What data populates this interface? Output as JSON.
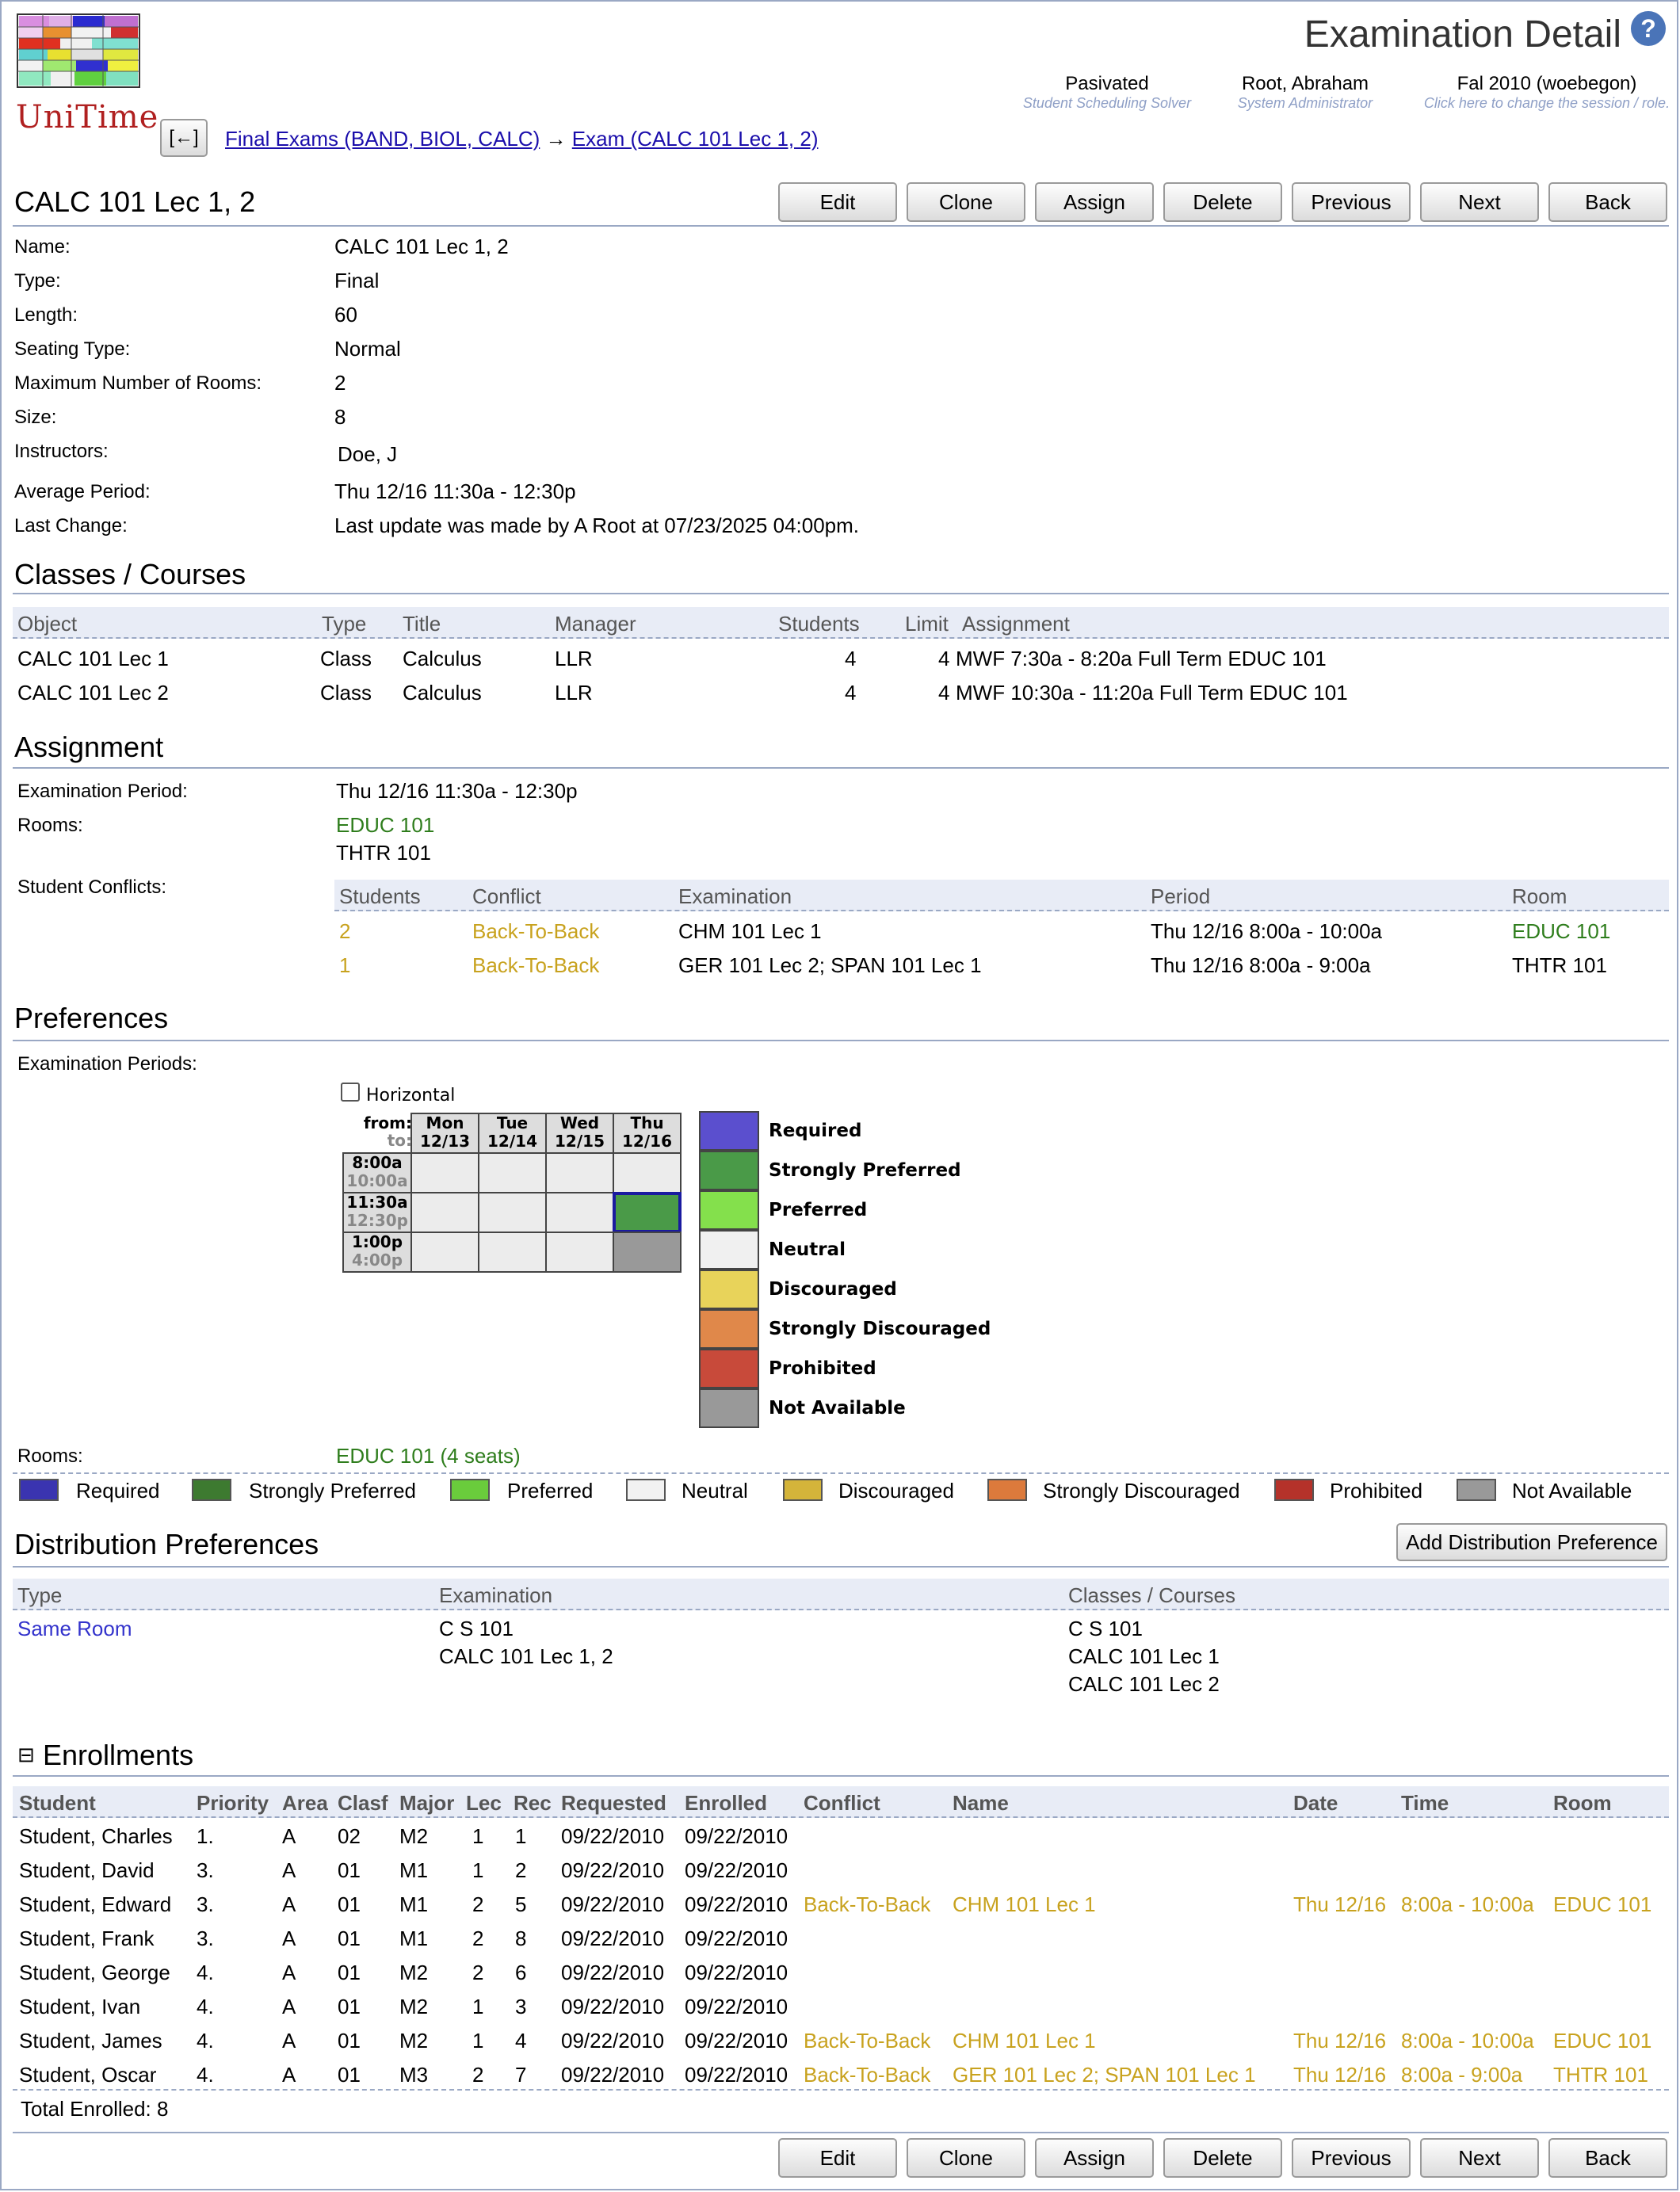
{
  "header": {
    "logo_text": "UniTime",
    "page_title": "Examination Detail",
    "help_icon": "help-icon",
    "status": [
      {
        "value": "Pasivated",
        "caption": "Student Scheduling Solver"
      },
      {
        "value": "Root, Abraham",
        "caption": "System Administrator"
      },
      {
        "value": "Fal 2010 (woebegon)",
        "caption": "Click here to change the session / role."
      }
    ],
    "back_arrow": "[←]",
    "breadcrumb": {
      "link1": "Final Exams (BAND, BIOL, CALC)",
      "arrow": "→",
      "link2": "Exam (CALC 101 Lec 1, 2)"
    }
  },
  "exam_title": "CALC 101 Lec 1, 2",
  "buttons": {
    "edit": "Edit",
    "clone": "Clone",
    "assign": "Assign",
    "delete": "Delete",
    "previous": "Previous",
    "next": "Next",
    "back": "Back"
  },
  "details": [
    {
      "label": "Name:",
      "value": "CALC 101 Lec 1, 2"
    },
    {
      "label": "Type:",
      "value": "Final"
    },
    {
      "label": "Length:",
      "value": "60"
    },
    {
      "label": "Seating Type:",
      "value": "Normal"
    },
    {
      "label": "Maximum Number of Rooms:",
      "value": "2"
    },
    {
      "label": "Size:",
      "value": "8"
    },
    {
      "label": "Instructors:",
      "value": "Doe, J"
    },
    {
      "label": "Average Period:",
      "value": "Thu 12/16 11:30a - 12:30p"
    },
    {
      "label": "Last Change:",
      "value": "Last update was made by A Root at 07/23/2025 04:00pm."
    }
  ],
  "classes": {
    "title": "Classes / Courses",
    "columns": [
      "Object",
      "Type",
      "Title",
      "Manager",
      "Students",
      "Limit",
      "Assignment"
    ],
    "rows": [
      {
        "object": "CALC 101 Lec 1",
        "type": "Class",
        "title": "Calculus",
        "manager": "LLR",
        "students": "4",
        "limit": "4",
        "assignment": "MWF 7:30a - 8:20a Full Term EDUC 101"
      },
      {
        "object": "CALC 101 Lec 2",
        "type": "Class",
        "title": "Calculus",
        "manager": "LLR",
        "students": "4",
        "limit": "4",
        "assignment": "MWF 10:30a - 11:20a Full Term EDUC 101"
      }
    ]
  },
  "assignment": {
    "title": "Assignment",
    "period_label": "Examination Period:",
    "period_value": "Thu 12/16 11:30a - 12:30p",
    "rooms_label": "Rooms:",
    "rooms": [
      "EDUC 101",
      "THTR 101"
    ],
    "conflicts_label": "Student Conflicts:",
    "conflict_columns": [
      "Students",
      "Conflict",
      "Examination",
      "Period",
      "Room"
    ],
    "conflicts": [
      {
        "students": "2",
        "conflict": "Back-To-Back",
        "examination": "CHM 101 Lec 1",
        "period": "Thu 12/16 8:00a - 10:00a",
        "room": "EDUC 101"
      },
      {
        "students": "1",
        "conflict": "Back-To-Back",
        "examination": "GER 101 Lec 2; SPAN 101 Lec 1",
        "period": "Thu 12/16 8:00a - 9:00a",
        "room": "THTR 101"
      }
    ]
  },
  "preferences": {
    "title": "Preferences",
    "periods_label": "Examination Periods:",
    "horizontal_label": "Horizontal",
    "from_label": "from:",
    "to_label": "to:",
    "days": [
      {
        "day": "Mon",
        "date": "12/13"
      },
      {
        "day": "Tue",
        "date": "12/14"
      },
      {
        "day": "Wed",
        "date": "12/15"
      },
      {
        "day": "Thu",
        "date": "12/16"
      }
    ],
    "times": [
      {
        "from": "8:00a",
        "to": "10:00a"
      },
      {
        "from": "11:30a",
        "to": "12:30p"
      },
      {
        "from": "1:00p",
        "to": "4:00p"
      }
    ],
    "legend": [
      {
        "label": "Required",
        "color": "#5b4fce"
      },
      {
        "label": "Strongly Preferred",
        "color": "#4a9a48"
      },
      {
        "label": "Preferred",
        "color": "#84e04c"
      },
      {
        "label": "Neutral",
        "color": "#f0f0f0"
      },
      {
        "label": "Discouraged",
        "color": "#e8d35a"
      },
      {
        "label": "Strongly Discouraged",
        "color": "#e0884a"
      },
      {
        "label": "Prohibited",
        "color": "#c84a3a"
      },
      {
        "label": "Not Available",
        "color": "#999999"
      }
    ],
    "rooms_label": "Rooms:",
    "rooms_value": "EDUC 101 (4 seats)",
    "key": [
      {
        "label": "Required",
        "color": "#3a34b0"
      },
      {
        "label": "Strongly Preferred",
        "color": "#3d7a30"
      },
      {
        "label": "Preferred",
        "color": "#6acc3c"
      },
      {
        "label": "Neutral",
        "color": "#f2f2f2"
      },
      {
        "label": "Discouraged",
        "color": "#d4b43a"
      },
      {
        "label": "Strongly Discouraged",
        "color": "#dc7a3c"
      },
      {
        "label": "Prohibited",
        "color": "#b5322a"
      },
      {
        "label": "Not Available",
        "color": "#999999"
      }
    ]
  },
  "distribution": {
    "title": "Distribution Preferences",
    "add_button": "Add Distribution Preference",
    "columns": [
      "Type",
      "Examination",
      "Classes / Courses"
    ],
    "row": {
      "type": "Same Room",
      "examinations": [
        "C S 101",
        "CALC 101 Lec 1, 2"
      ],
      "classes": [
        "C S 101",
        "CALC 101 Lec 1",
        "CALC 101 Lec 2"
      ]
    }
  },
  "enrollments": {
    "title": "Enrollments",
    "collapse_icon": "⊟",
    "columns": [
      "Student",
      "Priority",
      "Area",
      "Clasf",
      "Major",
      "Lec",
      "Rec",
      "Requested",
      "Enrolled",
      "Conflict",
      "Name",
      "Date",
      "Time",
      "Room"
    ],
    "rows": [
      {
        "student": "Student, Charles",
        "priority": "1.",
        "area": "A",
        "clasf": "02",
        "major": "M2",
        "lec": "1",
        "rec": "1",
        "requested": "09/22/2010",
        "enrolled": "09/22/2010",
        "conflict": "",
        "name": "",
        "date": "",
        "time": "",
        "room": ""
      },
      {
        "student": "Student, David",
        "priority": "3.",
        "area": "A",
        "clasf": "01",
        "major": "M1",
        "lec": "1",
        "rec": "2",
        "requested": "09/22/2010",
        "enrolled": "09/22/2010",
        "conflict": "",
        "name": "",
        "date": "",
        "time": "",
        "room": ""
      },
      {
        "student": "Student, Edward",
        "priority": "3.",
        "area": "A",
        "clasf": "01",
        "major": "M1",
        "lec": "2",
        "rec": "5",
        "requested": "09/22/2010",
        "enrolled": "09/22/2010",
        "conflict": "Back-To-Back",
        "name": "CHM 101 Lec 1",
        "date": "Thu 12/16",
        "time": "8:00a - 10:00a",
        "room": "EDUC 101"
      },
      {
        "student": "Student, Frank",
        "priority": "3.",
        "area": "A",
        "clasf": "01",
        "major": "M1",
        "lec": "2",
        "rec": "8",
        "requested": "09/22/2010",
        "enrolled": "09/22/2010",
        "conflict": "",
        "name": "",
        "date": "",
        "time": "",
        "room": ""
      },
      {
        "student": "Student, George",
        "priority": "4.",
        "area": "A",
        "clasf": "01",
        "major": "M2",
        "lec": "2",
        "rec": "6",
        "requested": "09/22/2010",
        "enrolled": "09/22/2010",
        "conflict": "",
        "name": "",
        "date": "",
        "time": "",
        "room": ""
      },
      {
        "student": "Student, Ivan",
        "priority": "4.",
        "area": "A",
        "clasf": "01",
        "major": "M2",
        "lec": "1",
        "rec": "3",
        "requested": "09/22/2010",
        "enrolled": "09/22/2010",
        "conflict": "",
        "name": "",
        "date": "",
        "time": "",
        "room": ""
      },
      {
        "student": "Student, James",
        "priority": "4.",
        "area": "A",
        "clasf": "01",
        "major": "M2",
        "lec": "1",
        "rec": "4",
        "requested": "09/22/2010",
        "enrolled": "09/22/2010",
        "conflict": "Back-To-Back",
        "name": "CHM 101 Lec 1",
        "date": "Thu 12/16",
        "time": "8:00a - 10:00a",
        "room": "EDUC 101"
      },
      {
        "student": "Student, Oscar",
        "priority": "4.",
        "area": "A",
        "clasf": "01",
        "major": "M3",
        "lec": "2",
        "rec": "7",
        "requested": "09/22/2010",
        "enrolled": "09/22/2010",
        "conflict": "Back-To-Back",
        "name": "GER 101 Lec 2; SPAN 101 Lec 1",
        "date": "Thu 12/16",
        "time": "8:00a - 9:00a",
        "room": "THTR 101"
      }
    ],
    "total": "Total Enrolled: 8"
  }
}
